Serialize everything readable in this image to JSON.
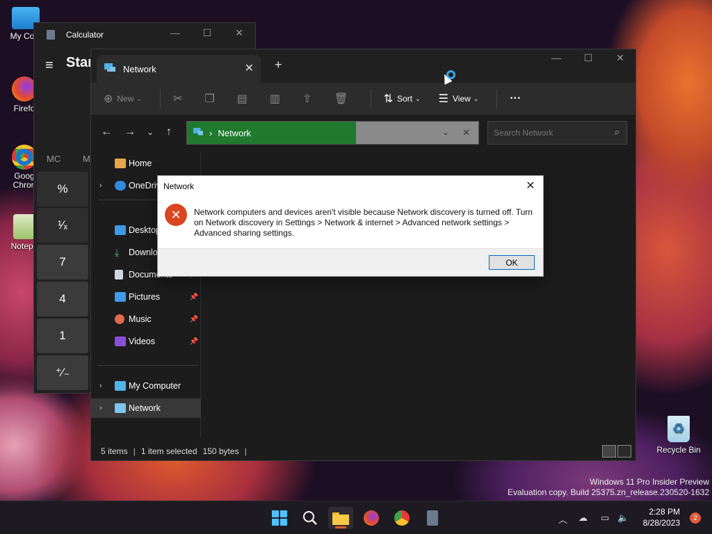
{
  "desktop": {
    "icons": [
      {
        "label": "My Com"
      },
      {
        "label": "Firefo"
      },
      {
        "label": "Goog Chron"
      },
      {
        "label": "Notepa"
      }
    ],
    "recycle_bin": "Recycle Bin",
    "watermark": {
      "line1": "Windows 11 Pro Insider Preview",
      "line2": "Evaluation copy. Build 25375.zn_release.230520-1632"
    }
  },
  "calculator": {
    "title": "Calculator",
    "mode": "Star",
    "memory": [
      "MC",
      "M"
    ],
    "keys": [
      "%",
      "¹⁄ₓ",
      "7",
      "4",
      "1",
      "⁺⁄₋"
    ]
  },
  "explorer": {
    "tab_label": "Network",
    "toolbar": {
      "new_label": "New",
      "sort_label": "Sort",
      "view_label": "View",
      "more_label": "···"
    },
    "address": {
      "path": "Network",
      "progress_fraction": 0.58
    },
    "search_placeholder": "Search Network",
    "nav": [
      {
        "label": "Home",
        "expandable": false,
        "pinned": false
      },
      {
        "label": "OneDrive",
        "expandable": true,
        "pinned": false
      },
      {
        "label": "Desktop",
        "expandable": false,
        "pinned": true
      },
      {
        "label": "Downloads",
        "expandable": false,
        "pinned": true
      },
      {
        "label": "Documents",
        "expandable": false,
        "pinned": true
      },
      {
        "label": "Pictures",
        "expandable": false,
        "pinned": true
      },
      {
        "label": "Music",
        "expandable": false,
        "pinned": true
      },
      {
        "label": "Videos",
        "expandable": false,
        "pinned": true
      },
      {
        "label": "My Computer",
        "expandable": true,
        "pinned": false
      },
      {
        "label": "Network",
        "expandable": true,
        "pinned": false
      }
    ],
    "status": {
      "items": "5 items",
      "selected": "1 item selected",
      "size": "150 bytes"
    }
  },
  "dialog": {
    "title": "Network",
    "message": "Network computers and devices aren't visible because Network discovery is turned off. Turn on Network discovery in Settings > Network & internet > Advanced network settings > Advanced sharing settings.",
    "ok_label": "OK"
  },
  "taskbar": {
    "clock_time": "2:28 PM",
    "clock_date": "8/28/2023",
    "notification_count": "2"
  },
  "colors": {
    "accent": "#0067c0",
    "address_progress": "#1f7a2e",
    "error_icon": "#d9461f",
    "notification_badge": "#e05a3a"
  }
}
